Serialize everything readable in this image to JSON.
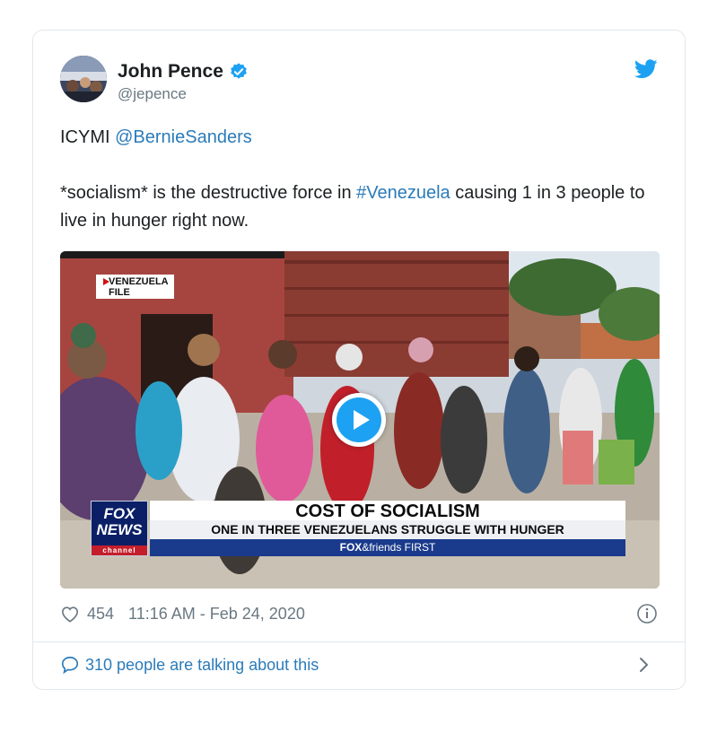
{
  "tweet": {
    "author": {
      "display_name": "John Pence",
      "handle": "@jepence",
      "verified": true,
      "avatar_icon": "avatar-photo"
    },
    "text": {
      "line1_prefix": "ICYMI",
      "mention": "@BernieSanders",
      "line2_part1": "*socialism* is the destructive force in",
      "hashtag": "#Venezuela",
      "line2_part2": "causing 1 in 3 people to live in hunger right now."
    },
    "media": {
      "file_tag_line1": "VENEZUELA",
      "file_tag_line2": "FILE",
      "headline": "COST OF SOCIALISM",
      "subheadline": "ONE IN THREE VENEZUELANS STRUGGLE WITH HUNGER",
      "show_brand_fox": "FOX",
      "show_brand_rest": "&friends FIRST",
      "network_line1": "FOX",
      "network_line2": "NEWS",
      "network_line3": "channel",
      "play_icon": "play-icon"
    },
    "meta": {
      "likes": "454",
      "timestamp": "11:16 AM - Feb 24, 2020",
      "heart_icon": "heart-icon",
      "info_icon": "info-icon"
    },
    "footer": {
      "conversation": "310 people are talking about this",
      "bubble_icon": "comment-bubble-icon",
      "chevron_icon": "chevron-right-icon"
    }
  },
  "colors": {
    "link": "#2b7bb9",
    "twitter_blue": "#1da1f2",
    "muted": "#697882",
    "border": "#e1e8ed"
  }
}
